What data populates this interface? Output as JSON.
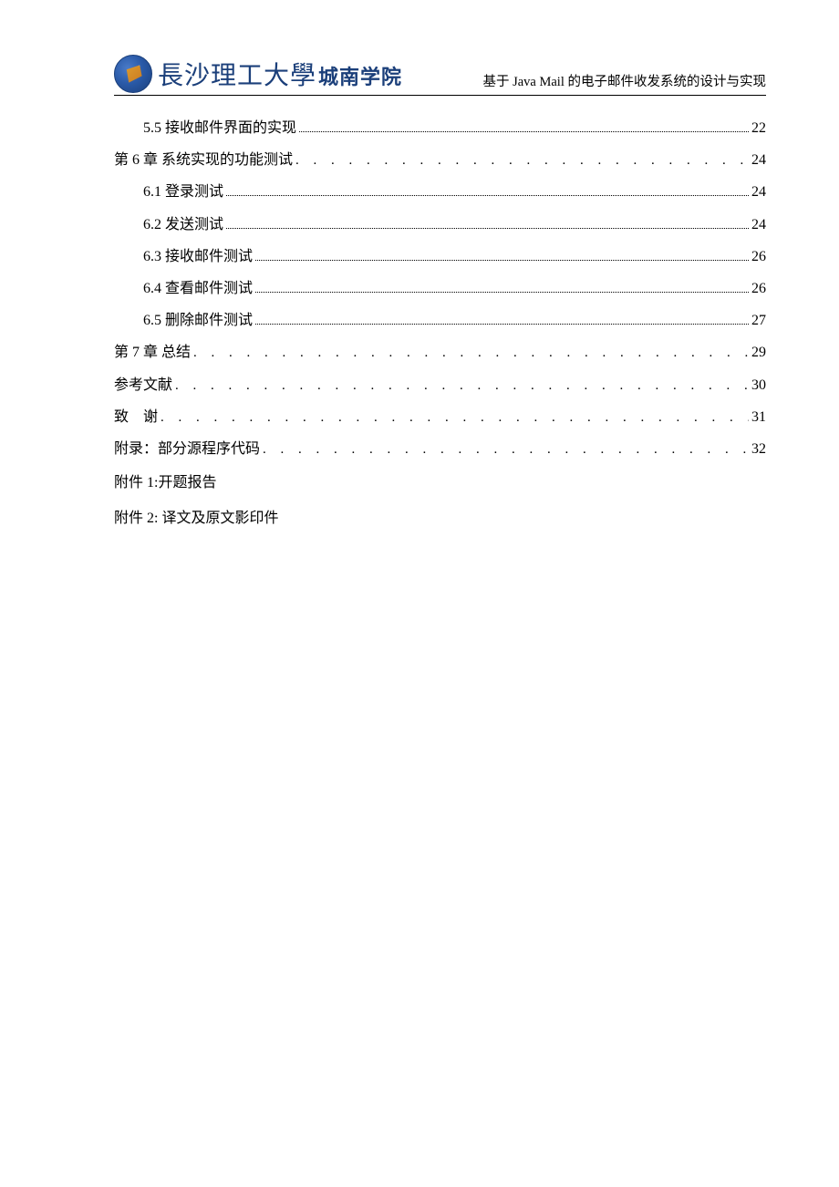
{
  "header": {
    "university_script": "長沙理工大學",
    "college": "城南学院",
    "doc_title": "基于 Java Mail 的电子邮件收发系统的设计与实现"
  },
  "toc": {
    "entries": [
      {
        "level": 2,
        "label": "5.5  接收邮件界面的实现",
        "page": "22",
        "dot_style": "tight"
      },
      {
        "level": 1,
        "label": "第 6 章  系统实现的功能测试",
        "page": "24",
        "dot_style": "spaced"
      },
      {
        "level": 2,
        "label": "6.1  登录测试",
        "page": "24",
        "dot_style": "tight"
      },
      {
        "level": 2,
        "label": "6.2 发送测试",
        "page": "24",
        "dot_style": "tight"
      },
      {
        "level": 2,
        "label": "6.3 接收邮件测试",
        "page": "26",
        "dot_style": "tight"
      },
      {
        "level": 2,
        "label": "6.4 查看邮件测试",
        "page": "26",
        "dot_style": "tight"
      },
      {
        "level": 2,
        "label": "6.5 删除邮件测试",
        "page": "27",
        "dot_style": "tight"
      },
      {
        "level": 1,
        "label": "第 7 章  总结",
        "page": "29",
        "dot_style": "spaced"
      },
      {
        "level": 1,
        "label": "参考文献",
        "page": "30",
        "dot_style": "spaced"
      },
      {
        "level": 1,
        "label": "致　谢",
        "page": "31",
        "dot_style": "spaced"
      },
      {
        "level": 1,
        "label": "附录：部分源程序代码",
        "page": "32",
        "dot_style": "spaced"
      }
    ],
    "plain_lines": [
      "附件 1:开题报告",
      "附件 2:  译文及原文影印件"
    ]
  }
}
